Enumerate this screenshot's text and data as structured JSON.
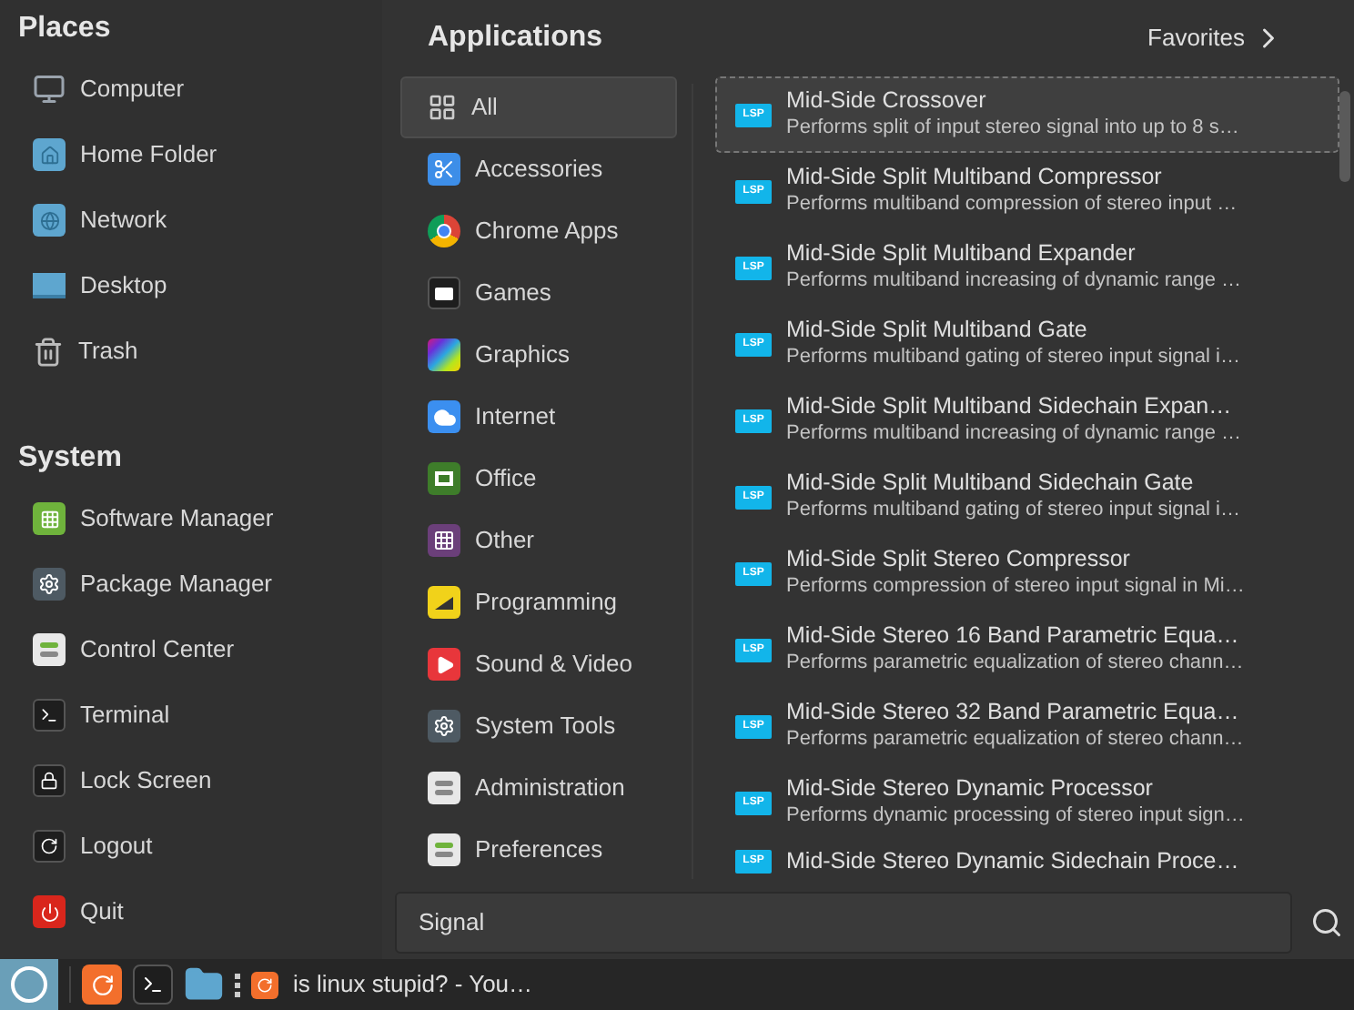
{
  "places": {
    "title": "Places",
    "items": [
      {
        "label": "Computer"
      },
      {
        "label": "Home Folder"
      },
      {
        "label": "Network"
      },
      {
        "label": "Desktop"
      },
      {
        "label": "Trash"
      }
    ]
  },
  "system": {
    "title": "System",
    "items": [
      {
        "label": "Software Manager"
      },
      {
        "label": "Package Manager"
      },
      {
        "label": "Control Center"
      },
      {
        "label": "Terminal"
      },
      {
        "label": "Lock Screen"
      },
      {
        "label": "Logout"
      },
      {
        "label": "Quit"
      }
    ]
  },
  "applications": {
    "title": "Applications",
    "favorites_link": "Favorites",
    "categories": [
      {
        "label": "All",
        "selected": true
      },
      {
        "label": "Accessories",
        "selected": false
      },
      {
        "label": "Chrome Apps",
        "selected": false
      },
      {
        "label": "Games",
        "selected": false
      },
      {
        "label": "Graphics",
        "selected": false
      },
      {
        "label": "Internet",
        "selected": false
      },
      {
        "label": "Office",
        "selected": false
      },
      {
        "label": "Other",
        "selected": false
      },
      {
        "label": "Programming",
        "selected": false
      },
      {
        "label": "Sound & Video",
        "selected": false
      },
      {
        "label": "System Tools",
        "selected": false
      },
      {
        "label": "Administration",
        "selected": false
      },
      {
        "label": "Preferences",
        "selected": false
      }
    ],
    "apps": [
      {
        "name": "Mid-Side Crossover",
        "description": "Performs split of input stereo signal into up to 8 s…",
        "icon_text": "LSP",
        "selected": true
      },
      {
        "name": "Mid-Side Split Multiband Compressor",
        "description": "Performs multiband compression of stereo input …",
        "icon_text": "LSP",
        "selected": false
      },
      {
        "name": "Mid-Side Split Multiband Expander",
        "description": "Performs multiband increasing of dynamic range …",
        "icon_text": "LSP",
        "selected": false
      },
      {
        "name": "Mid-Side Split Multiband Gate",
        "description": "Performs multiband gating of stereo input signal i…",
        "icon_text": "LSP",
        "selected": false
      },
      {
        "name": "Mid-Side Split Multiband Sidechain Expan…",
        "description": "Performs multiband increasing of dynamic range …",
        "icon_text": "LSP",
        "selected": false
      },
      {
        "name": "Mid-Side Split Multiband Sidechain Gate",
        "description": "Performs multiband gating of stereo input signal i…",
        "icon_text": "LSP",
        "selected": false
      },
      {
        "name": "Mid-Side Split Stereo Compressor",
        "description": "Performs compression of stereo input signal in Mi…",
        "icon_text": "LSP",
        "selected": false
      },
      {
        "name": "Mid-Side Stereo 16 Band Parametric Equa…",
        "description": "Performs parametric equalization of stereo chann…",
        "icon_text": "LSP",
        "selected": false
      },
      {
        "name": "Mid-Side Stereo 32 Band Parametric Equa…",
        "description": "Performs parametric equalization of stereo chann…",
        "icon_text": "LSP",
        "selected": false
      },
      {
        "name": "Mid-Side Stereo Dynamic Processor",
        "description": "Performs dynamic processing of stereo input sign…",
        "icon_text": "LSP",
        "selected": false
      },
      {
        "name": "Mid-Side Stereo Dynamic Sidechain Proce…",
        "icon_text": "LSP",
        "selected": false
      }
    ]
  },
  "search": {
    "value": "Signal"
  },
  "taskbar": {
    "window_title": "is linux stupid? - You…"
  }
}
